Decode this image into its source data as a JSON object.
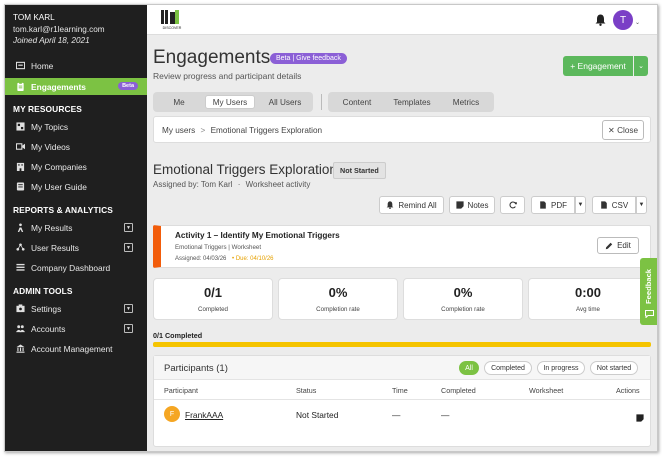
{
  "user": {
    "name": "TOM KARL",
    "email": "tom.karl@r1learning.com",
    "joined": "Joined April 18, 2021"
  },
  "sidebar": {
    "items": [
      {
        "label": "Home",
        "icon": "home-icon"
      },
      {
        "label": "Engagements",
        "icon": "clipboard-icon",
        "badge": "Beta"
      }
    ],
    "sections": [
      {
        "title": "MY RESOURCES",
        "items": [
          {
            "label": "My Topics",
            "icon": "topics-icon"
          },
          {
            "label": "My Videos",
            "icon": "video-icon"
          },
          {
            "label": "My Companies",
            "icon": "building-icon"
          },
          {
            "label": "My User Guide",
            "icon": "book-icon"
          }
        ]
      },
      {
        "title": "REPORTS & ANALYTICS",
        "items": [
          {
            "label": "My Results",
            "icon": "results-icon"
          },
          {
            "label": "User Results",
            "icon": "users-results-icon"
          },
          {
            "label": "Company Dashboard",
            "icon": "dashboard-icon"
          }
        ]
      },
      {
        "title": "ADMIN TOOLS",
        "items": [
          {
            "label": "Settings",
            "icon": "settings-icon"
          },
          {
            "label": "Accounts",
            "icon": "accounts-icon"
          },
          {
            "label": "Account Management",
            "icon": "account-management-icon"
          }
        ]
      }
    ]
  },
  "topbar": {
    "logo_text": "DISCOVER",
    "avatar_initial": "T"
  },
  "header": {
    "title": "Engagements",
    "badge": "Beta | Give feedback",
    "subtitle": "Review progress and participant details",
    "primary_button": "+ Engagement"
  },
  "tabs": {
    "group_a": [
      "Me",
      "My Users",
      "All Users"
    ],
    "group_b": [
      "Content",
      "Templates",
      "Metrics"
    ],
    "active": "My Users"
  },
  "breadcrumb": {
    "root": "My users",
    "separator": ">",
    "current": "Emotional Triggers Exploration",
    "close_label": "✕ Close"
  },
  "engagement": {
    "title": "Emotional Triggers Exploration",
    "status": "Not Started",
    "assigned_by": "Assigned by: Tom Karl",
    "activity_type": "Worksheet activity",
    "separator": "·"
  },
  "toolbar": {
    "remind_all": "Remind All",
    "notes": "Notes",
    "pdf": "PDF",
    "csv": "CSV"
  },
  "activity": {
    "title": "Activity 1 – Identify My Emotional Triggers",
    "type": "Emotional Triggers | Worksheet",
    "assigned": "Assigned: 04/03/26",
    "due": "• Due: 04/10/26",
    "edit_label": "Edit"
  },
  "stats": [
    {
      "value": "0/1",
      "label": "Completed"
    },
    {
      "value": "0%",
      "label": "Completion rate"
    },
    {
      "value": "0%",
      "label": "Completion rate"
    },
    {
      "value": "0:00",
      "label": "Avg time"
    }
  ],
  "progress": {
    "label": "0/1 Completed",
    "fraction": 1.0
  },
  "participants": {
    "title": "Participants (1)",
    "filters": [
      "All",
      "Completed",
      "In progress",
      "Not started"
    ],
    "active_filter": "All",
    "columns": [
      "Participant",
      "Status",
      "Time",
      "Completed",
      "Worksheet",
      "Actions"
    ],
    "rows": [
      {
        "initial": "F",
        "name": "FrankAAA",
        "status": "Not Started",
        "time": "—",
        "completed": "—",
        "worksheet": ""
      }
    ]
  },
  "feedback": {
    "label": "Feedback"
  },
  "colors": {
    "accent_green": "#7cc243",
    "button_green": "#5cb85c",
    "purple": "#8b5fd6",
    "activity_orange": "#f25c0a",
    "progress_yellow": "#f5c400",
    "sidebar_bg": "#1f1f1f"
  }
}
